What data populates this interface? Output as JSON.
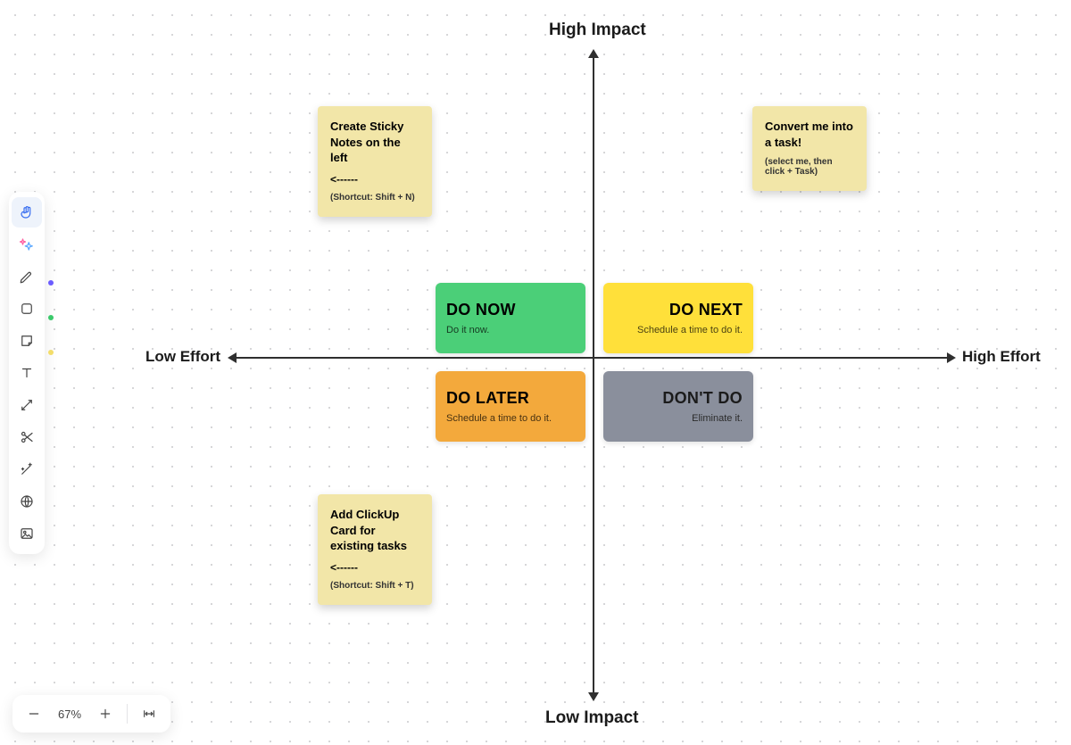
{
  "axes": {
    "top": "High Impact",
    "bottom": "Low Impact",
    "left": "Low Effort",
    "right": "High Effort"
  },
  "stickies": {
    "create": {
      "title": "Create Sticky Notes on the left",
      "arrow": "<------",
      "hint": "(Shortcut: Shift + N)"
    },
    "convert": {
      "title": "Convert me into a task!",
      "sub": "(select me, then click + Task)"
    },
    "addcard": {
      "title": "Add ClickUp Card for existing tasks",
      "arrow": "<------",
      "hint": "(Shortcut: Shift + T)"
    }
  },
  "quadrants": {
    "donow": {
      "title": "DO NOW",
      "sub": "Do it now."
    },
    "donext": {
      "title": "DO NEXT",
      "sub": "Schedule a time to do it."
    },
    "dolater": {
      "title": "DO LATER",
      "sub": "Schedule a time to do it."
    },
    "dontdo": {
      "title": "DON'T DO",
      "sub": "Eliminate it."
    }
  },
  "zoom": {
    "level": "67%"
  },
  "colors": {
    "sticky": "#f2e6a8",
    "donow": "#4bcf78",
    "donext": "#ffe03a",
    "dolater": "#f3a93c",
    "dontdo": "#8a8f9c"
  }
}
